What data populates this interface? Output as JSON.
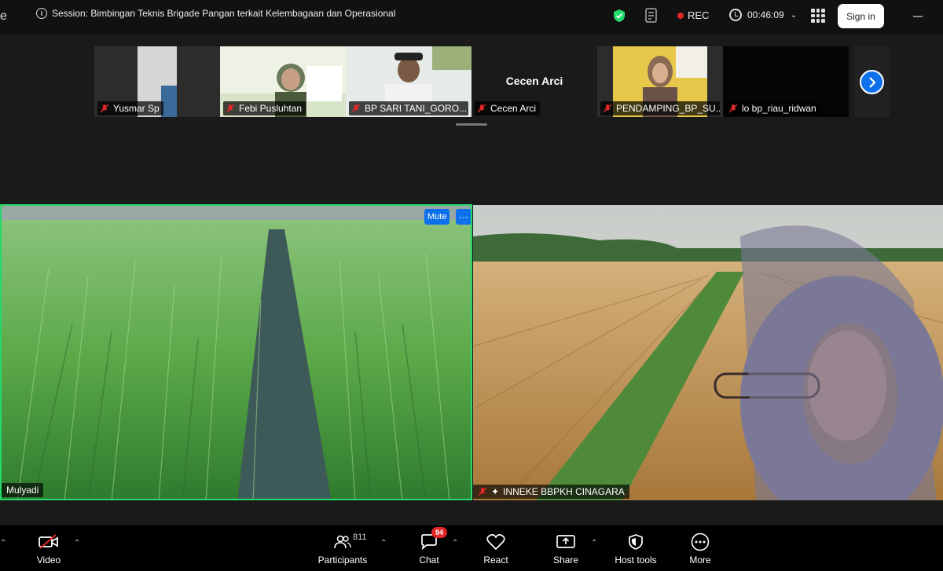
{
  "app": {
    "title_fragment": "e"
  },
  "session": {
    "title": "Session: Bimbingan Teknis Brigade Pangan terkait Kelembagaan dan Operasional"
  },
  "recording": {
    "label": "REC"
  },
  "timer": {
    "elapsed": "00:46:09"
  },
  "header": {
    "sign_in": "Sign in"
  },
  "participants_strip": [
    {
      "name": "Yusmar Sp",
      "muted": true
    },
    {
      "name": "Febi Pusluhtan",
      "muted": true
    },
    {
      "name": "BP SARI TANI_GORO...",
      "muted": true
    },
    {
      "name": "Cecen Arci",
      "display_name": "Cecen Arci",
      "muted": true
    },
    {
      "name": "PENDAMPING_BP_SU...",
      "muted": true
    },
    {
      "name": "lo bp_riau_ridwan",
      "muted": true
    }
  ],
  "videos": {
    "left": {
      "name": "Mulyadi",
      "mute_label": "Mute",
      "more_label": "···"
    },
    "right": {
      "name": "INNEKE BBPKH CINAGARA"
    }
  },
  "toolbar": {
    "video": "Video",
    "participants": "Participants",
    "participants_count": "811",
    "chat": "Chat",
    "chat_badge": "94",
    "react": "React",
    "share": "Share",
    "host_tools": "Host tools",
    "more": "More"
  },
  "colors": {
    "accent": "#0e71eb",
    "speaker_border": "#23d96c",
    "rec": "#e02828",
    "shield": "#23d96c"
  }
}
